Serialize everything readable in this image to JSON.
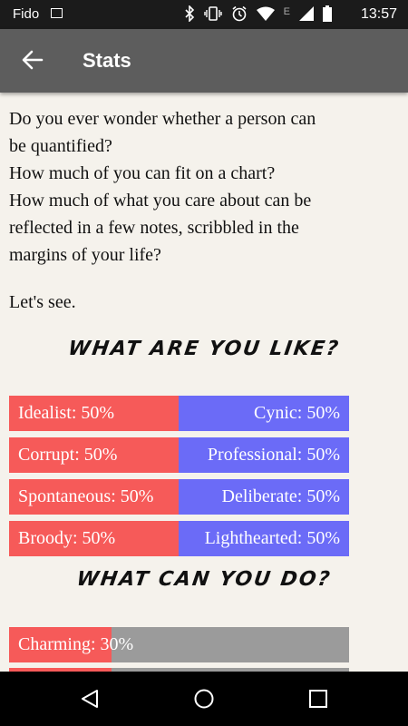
{
  "status_bar": {
    "carrier": "Fido",
    "time": "13:57",
    "network_label": "E"
  },
  "app_bar": {
    "title": "Stats"
  },
  "story": {
    "paragraph1": [
      "Do you ever wonder whether a person can",
      "be quantified?",
      "How much of you can fit on a chart?",
      "How much of what you care about can be",
      "reflected in a few notes, scribbled in the",
      "margins of your life?"
    ],
    "paragraph2": "Let's see."
  },
  "section_like": {
    "title": "WHAT ARE YOU LIKE?"
  },
  "traits": [
    {
      "left": "Idealist: 50%",
      "right": "Cynic: 50%"
    },
    {
      "left": "Corrupt: 50%",
      "right": "Professional: 50%"
    },
    {
      "left": "Spontaneous: 50%",
      "right": "Deliberate: 50%"
    },
    {
      "left": "Broody: 50%",
      "right": "Lighthearted: 50%"
    }
  ],
  "section_do": {
    "title": "WHAT CAN YOU DO?"
  },
  "skills": [
    {
      "label": "Charming: 30%",
      "value": 30
    },
    {
      "label": "",
      "value": 30
    }
  ],
  "colors": {
    "left_bar": "#f65a59",
    "right_bar": "#6b6bf7",
    "skill_empty": "#9b9b9b",
    "app_bar": "#5d5d5d"
  }
}
